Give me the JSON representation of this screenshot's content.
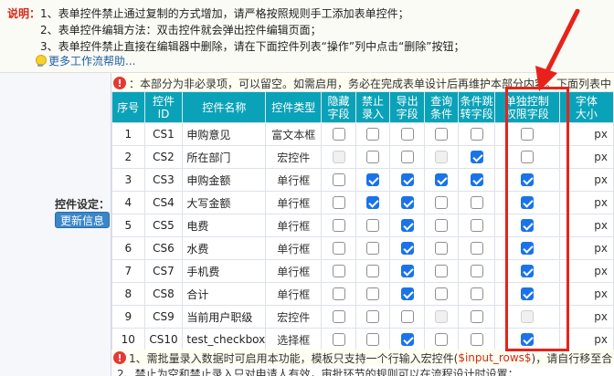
{
  "instructions": {
    "label": "说明：",
    "lines": [
      "1、表单控件禁止通过复制的方式增加，请严格按照规则手工添加表单控件；",
      "2、表单控件编辑方法：双击控件就会弹出控件编辑页面；",
      "3、表单控件禁止直接在编辑器中删除，请在下面控件列表“操作”列中点击“删除”按钮；"
    ],
    "help_link": "更多工作流帮助..."
  },
  "left": {
    "label": "控件设定：",
    "update_button": "更新信息"
  },
  "notice_top": "：本部分为非必录项，可以留空。如需启用，务必在完成表单设计后再维护本部分内容。下面列表中",
  "notice_bottom": {
    "prefix": "1、需批量录入数据时可启用本功能，模板只支持一个行输入宏控件(",
    "highlight": "$input_rows$",
    "suffix": ")，请自行移至合"
  },
  "notice_bottom2": "2、禁止为空和禁止录入只对申请人有效，审批环节的规则可以在流程设计时设置；",
  "table": {
    "headers": [
      [
        "序号"
      ],
      [
        "控件",
        "ID"
      ],
      [
        "控件名称"
      ],
      [
        "控件类型"
      ],
      [
        "隐藏",
        "字段"
      ],
      [
        "禁止",
        "录入"
      ],
      [
        "导出",
        "字段"
      ],
      [
        "查询",
        "条件"
      ],
      [
        "条件跳",
        "转字段"
      ],
      [
        "单独控制",
        "权限字段"
      ],
      [
        "字体",
        "大小"
      ]
    ],
    "unit": "px",
    "rows": [
      {
        "no": "1",
        "id": "CS1",
        "name": "申购意见",
        "type": "富文本框",
        "checks": [
          "off",
          "off",
          "off",
          "off",
          "off",
          "off"
        ]
      },
      {
        "no": "2",
        "id": "CS2",
        "name": "所在部门",
        "type": "宏控件",
        "checks": [
          "dis",
          "off",
          "off",
          "dis",
          "on",
          "off"
        ]
      },
      {
        "no": "3",
        "id": "CS3",
        "name": "申购金额",
        "type": "单行框",
        "checks": [
          "off",
          "on",
          "on",
          "on",
          "on",
          "on"
        ]
      },
      {
        "no": "4",
        "id": "CS4",
        "name": "大写金额",
        "type": "单行框",
        "checks": [
          "off",
          "on",
          "on",
          "off",
          "off",
          "on"
        ]
      },
      {
        "no": "5",
        "id": "CS5",
        "name": "电费",
        "type": "单行框",
        "checks": [
          "off",
          "off",
          "on",
          "off",
          "off",
          "on"
        ]
      },
      {
        "no": "6",
        "id": "CS6",
        "name": "水费",
        "type": "单行框",
        "checks": [
          "off",
          "off",
          "on",
          "off",
          "off",
          "on"
        ]
      },
      {
        "no": "7",
        "id": "CS7",
        "name": "手机费",
        "type": "单行框",
        "checks": [
          "off",
          "off",
          "on",
          "off",
          "off",
          "on"
        ]
      },
      {
        "no": "8",
        "id": "CS8",
        "name": "合计",
        "type": "单行框",
        "checks": [
          "off",
          "off",
          "on",
          "off",
          "off",
          "on"
        ]
      },
      {
        "no": "9",
        "id": "CS9",
        "name": "当前用户职级",
        "type": "宏控件",
        "checks": [
          "off",
          "off",
          "off",
          "dis",
          "off",
          "dis"
        ]
      },
      {
        "no": "10",
        "id": "CS10",
        "name": "test_checkbox",
        "type": "选择框",
        "checks": [
          "off",
          "off",
          "on",
          "off",
          "off",
          "on"
        ]
      }
    ]
  },
  "colors": {
    "header_bg": "#0aa2b8",
    "highlight": "#e8221b",
    "checkbox_on": "#1a73e8",
    "link": "#1f5fa8"
  }
}
